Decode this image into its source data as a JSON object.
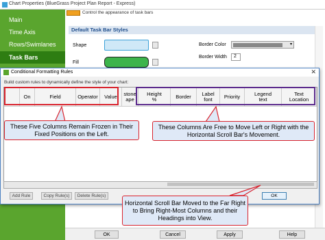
{
  "window": {
    "title": "Chart Properties (BlueGrass Project Plan Report - Express)"
  },
  "sidebar": {
    "items": [
      {
        "label": "Main"
      },
      {
        "label": "Time Axis"
      },
      {
        "label": "Rows/Swimlanes"
      },
      {
        "label": "Task Bars"
      }
    ]
  },
  "panel": {
    "hint": "Control the appearance of task bars",
    "section_title": "Default Task Bar Styles",
    "shape_label": "Shape",
    "fill_label": "Fill",
    "border_color_label": "Border Color",
    "border_width_label": "Border Width",
    "border_width_value": "2",
    "accent_color": "#5aa52e"
  },
  "footer": {
    "ok": "OK",
    "cancel": "Cancel",
    "apply": "Apply",
    "help": "Help"
  },
  "dialog": {
    "title": "Conditional Formatting Rules",
    "close": "✕",
    "description": "Build custom rules to dynamically define the style of your chart:",
    "columns": [
      "On",
      "Field",
      "Operator",
      "Value",
      "stone\nape",
      "Height\n%",
      "Border",
      "Label\nfont",
      "Priority",
      "Legend\ntext",
      "Text\nLocation"
    ],
    "buttons": {
      "add_rule": "Add Rule",
      "copy_rules": "Copy Rule(s)",
      "delete_rules": "Delete Rule(s)",
      "ok": "OK"
    }
  },
  "callouts": {
    "frozen": "These Five Columns Remain Frozen in Their Fixed Positions on the Left.",
    "free": "These Columns Are Free to Move Left or Right with the Horizontal Scroll Bar's Movement.",
    "scroll": "Horizontal Scroll Bar Moved to the Far Right to Bring Right-Most Columns and their Headings into View."
  }
}
